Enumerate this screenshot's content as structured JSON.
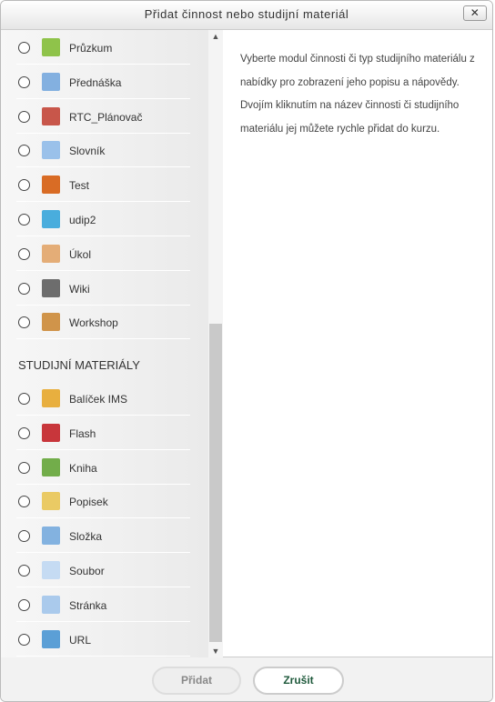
{
  "dialog": {
    "title": "Přidat činnost nebo studijní materiál",
    "close_label": "✕"
  },
  "activities": [
    {
      "label": "Průzkum",
      "icon": "chart-bar-icon",
      "color": "#7cba2c"
    },
    {
      "label": "Přednáška",
      "icon": "flowchart-icon",
      "color": "#6fa3dc"
    },
    {
      "label": "RTC_Plánovač",
      "icon": "calendar-icon",
      "color": "#c0392b"
    },
    {
      "label": "Slovník",
      "icon": "glossary-icon",
      "color": "#8ab7e8"
    },
    {
      "label": "Test",
      "icon": "quiz-check-icon",
      "color": "#d35400"
    },
    {
      "label": "udip2",
      "icon": "udip-icon",
      "color": "#2aa0d8"
    },
    {
      "label": "Úkol",
      "icon": "assignment-hand-icon",
      "color": "#e0a060"
    },
    {
      "label": "Wiki",
      "icon": "wiki-icon",
      "color": "#555555"
    },
    {
      "label": "Workshop",
      "icon": "workshop-icon",
      "color": "#c9822b"
    }
  ],
  "resources_header": "STUDIJNÍ MATERIÁLY",
  "resources": [
    {
      "label": "Balíček IMS",
      "icon": "package-boxes-icon",
      "color": "#e5a21f"
    },
    {
      "label": "Flash",
      "icon": "flash-icon",
      "color": "#c0141a"
    },
    {
      "label": "Kniha",
      "icon": "book-icon",
      "color": "#5aa02c"
    },
    {
      "label": "Popisek",
      "icon": "label-tag-icon",
      "color": "#e8c24a"
    },
    {
      "label": "Složka",
      "icon": "folder-icon",
      "color": "#6fa6dc"
    },
    {
      "label": "Soubor",
      "icon": "file-icon",
      "color": "#bcd6f2"
    },
    {
      "label": "Stránka",
      "icon": "page-icon",
      "color": "#9cc2ea"
    },
    {
      "label": "URL",
      "icon": "url-globe-icon",
      "color": "#3f8fd0"
    }
  ],
  "description": "Vyberte modul činnosti či typ studijního materiálu z nabídky pro zobrazení jeho popisu a nápovědy. Dvojím kliknutím na název činnosti či studijního materiálu jej můžete rychle přidat do kurzu.",
  "footer": {
    "add_label": "Přidat",
    "cancel_label": "Zrušit"
  }
}
